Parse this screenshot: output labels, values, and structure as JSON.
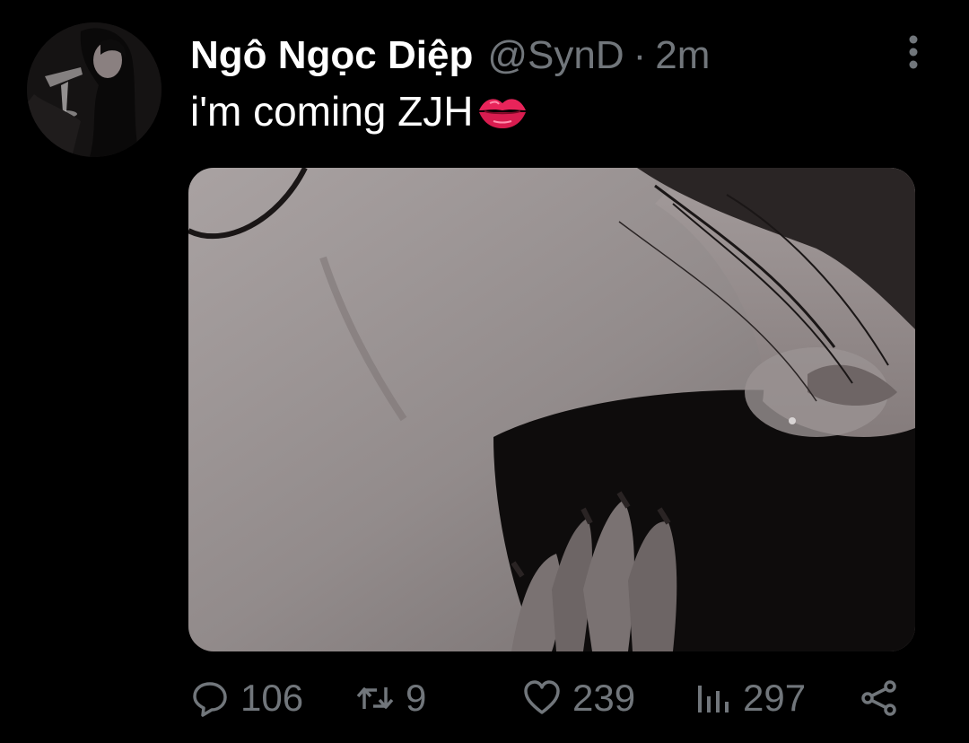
{
  "tweet": {
    "display_name": "Ngô Ngọc Diệp",
    "handle": "@SynD",
    "separator": "·",
    "time": "2m",
    "text": "i'm coming ZJH",
    "emoji": "kiss-mark-icon"
  },
  "actions": {
    "replies": "106",
    "retweets": "9",
    "likes": "239",
    "views": "297"
  },
  "icons": {
    "more": "more-vertical-icon",
    "reply": "reply-icon",
    "retweet": "retweet-icon",
    "like": "heart-icon",
    "views": "views-chart-icon",
    "share": "share-icon"
  },
  "colors": {
    "background": "#000000",
    "primary_text": "#ffffff",
    "secondary_text": "#71767b",
    "kiss": "#e8245a"
  }
}
